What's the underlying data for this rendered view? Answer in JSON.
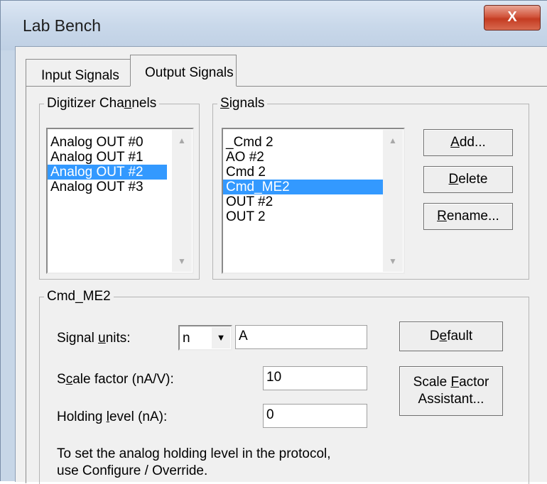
{
  "window": {
    "title": "Lab Bench",
    "close_glyph": "X"
  },
  "tabs": [
    {
      "label": "Input Signals",
      "selected": false
    },
    {
      "label": "Output Signals",
      "selected": true
    }
  ],
  "channels": {
    "title_pre": "Digitizer Cha",
    "title_u": "n",
    "title_post": "nels",
    "items": [
      "Analog OUT #0",
      "Analog OUT #1",
      "Analog OUT #2",
      "Analog OUT #3"
    ],
    "selected_index": 2
  },
  "signals": {
    "title_u": "S",
    "title_post": "ignals",
    "items": [
      "_Cmd 2",
      "AO #2",
      "Cmd 2",
      "Cmd_ME2",
      "OUT #2",
      "OUT 2"
    ],
    "selected_index": 3
  },
  "buttons": {
    "add": {
      "u": "A",
      "post": "dd..."
    },
    "delete": {
      "u": "D",
      "post": "elete"
    },
    "rename": {
      "u": "R",
      "post": "ename..."
    },
    "default": {
      "pre": "D",
      "u": "e",
      "post": "fault"
    },
    "scale_line1_pre": "Scale ",
    "scale_line1_u": "F",
    "scale_line1_post": "actor",
    "scale_line2": "Assistant..."
  },
  "signal_group": {
    "title": "Cmd_ME2",
    "units_label": {
      "pre": "Signal ",
      "u": "u",
      "post": "nits:"
    },
    "units_prefix": "n",
    "units_value": "A",
    "scale_label": {
      "pre": "S",
      "u": "c",
      "post": "ale factor (nA/V):"
    },
    "scale_value": "10",
    "holding_label": {
      "pre": "Holding ",
      "u": "l",
      "post": "evel (nA):"
    },
    "holding_value": "0",
    "note_line1": "To set the analog holding level in the protocol,",
    "note_line2": "use Configure / Override."
  },
  "colors": {
    "selection": "#3399ff",
    "close_button": "#c43c22",
    "titlebar": "#c9d8ea"
  }
}
